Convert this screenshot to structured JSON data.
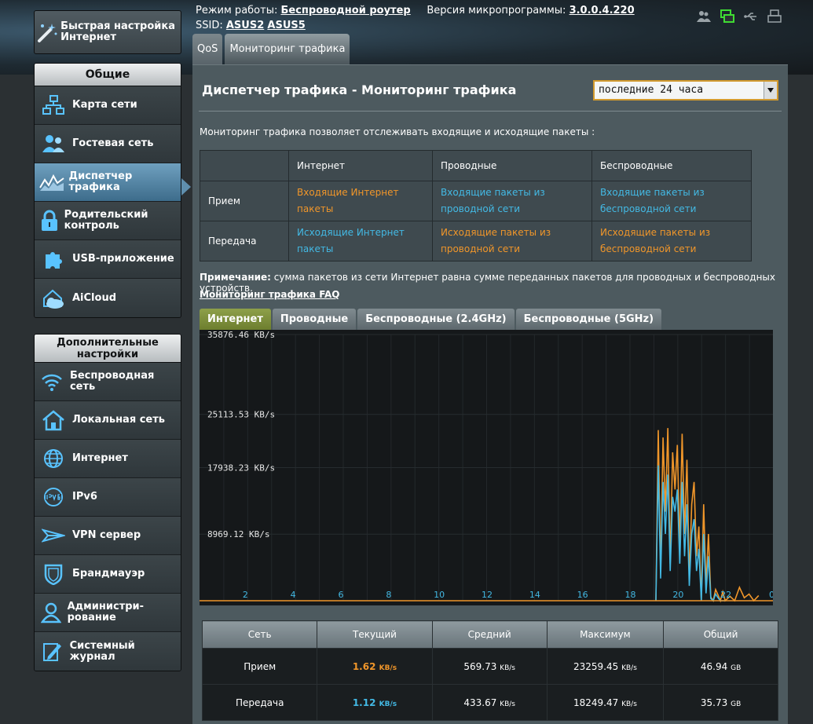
{
  "sidebar": {
    "qis_label": "Быстрая настройка Интернет",
    "general_header": "Общие",
    "general_items": [
      {
        "label": "Карта сети",
        "icon": "network-map-icon"
      },
      {
        "label": "Гостевая сеть",
        "icon": "guest-network-icon"
      },
      {
        "label": "Диспетчер трафика",
        "icon": "traffic-manager-icon",
        "active": true
      },
      {
        "label": "Родительский контроль",
        "icon": "parental-lock-icon"
      },
      {
        "label": "USB-приложение",
        "icon": "usb-puzzle-icon"
      },
      {
        "label": "AiCloud",
        "icon": "aicloud-icon"
      }
    ],
    "advanced_header": "Дополнительные настройки",
    "advanced_items": [
      {
        "label": "Беспроводная сеть",
        "icon": "wireless-icon"
      },
      {
        "label": "Локальная сеть",
        "icon": "home-lan-icon"
      },
      {
        "label": "Интернет",
        "icon": "globe-icon"
      },
      {
        "label": "IPv6",
        "icon": "ipv6-icon"
      },
      {
        "label": "VPN сервер",
        "icon": "vpn-icon"
      },
      {
        "label": "Брандмауэр",
        "icon": "firewall-shield-icon"
      },
      {
        "label": "Администри-рование",
        "icon": "admin-user-icon"
      },
      {
        "label": "Системный журнал",
        "icon": "system-log-icon"
      }
    ]
  },
  "topbar": {
    "mode_label": "Режим работы:",
    "mode_value": "Беспроводной роутер",
    "fw_label": "Версия микропрограммы:",
    "fw_value": "3.0.0.4.220",
    "ssid_label": "SSID:",
    "ssid1": "ASUS2",
    "ssid2": "ASUS5",
    "icons": [
      "clients-icon",
      "network-status-icon",
      "usb-status-icon",
      "printer-icon"
    ]
  },
  "tabs": [
    {
      "label": "QoS"
    },
    {
      "label": "Мониторинг трафика",
      "active": true
    }
  ],
  "main": {
    "title": "Диспетчер трафика - Мониторинг трафика",
    "period": "последние 24 часа",
    "description": "Мониторинг трафика позволяет отслеживать входящие и исходящие пакеты :",
    "legend": {
      "headers": [
        "",
        "Интернет",
        "Проводные",
        "Беспроводные"
      ],
      "rx_label": "Прием",
      "tx_label": "Передача",
      "rx": [
        "Входящие Интернет пакеты",
        "Входящие пакеты из проводной сети",
        "Входящие пакеты из беспроводной сети"
      ],
      "tx": [
        "Исходящие Интернет пакеты",
        "Исходящие пакеты из проводной сети",
        "Исходящие пакеты из беспроводной сети"
      ]
    },
    "note_label": "Примечание:",
    "note_text": "сумма пакетов из сети Интернет равна сумме переданных пакетов для проводных и беспроводных устройств.",
    "faq_link": "Мониторинг трафика FAQ",
    "chart_tabs": [
      {
        "label": "Интернет",
        "active": true
      },
      {
        "label": "Проводные"
      },
      {
        "label": "Беспроводные (2.4GHz)"
      },
      {
        "label": "Беспроводные (5GHz)"
      }
    ]
  },
  "chart_data": {
    "type": "line",
    "ylim": [
      0,
      35876.46
    ],
    "y_ticks": [
      "35876.46 KB/s",
      "25113.53 KB/s",
      "17938.23 KB/s",
      "8969.12 KB/s"
    ],
    "y_tick_values": [
      35876.46,
      25113.53,
      17938.23,
      8969.12
    ],
    "x_ticks": [
      "2",
      "4",
      "6",
      "8",
      "10",
      "12",
      "14",
      "16",
      "18",
      "20",
      "22",
      "0"
    ],
    "series": [
      {
        "color": "#f0962a",
        "x": [
          19.1,
          19.2,
          19.3,
          19.4,
          19.5,
          19.6,
          19.7,
          19.8,
          19.9,
          20.0,
          20.1,
          20.2,
          20.3,
          20.4,
          20.5,
          20.6,
          20.7,
          20.8,
          20.9,
          21.0,
          21.1,
          21.2,
          21.3,
          21.4,
          21.5,
          21.6,
          21.7,
          21.8,
          21.9,
          22.0,
          22.2,
          22.4,
          22.6,
          22.8,
          23.0,
          23.2,
          23.4
        ],
        "values": [
          0,
          23000,
          4000,
          22000,
          12000,
          23259,
          5000,
          20000,
          15000,
          21000,
          7000,
          22500,
          9000,
          19000,
          3000,
          13000,
          16000,
          6000,
          10000,
          0,
          13000,
          2000,
          9000,
          500,
          0,
          1500,
          800,
          0,
          1200,
          0,
          600,
          0,
          1800,
          400,
          900,
          0,
          700
        ]
      },
      {
        "color": "#43b9e4",
        "x": [
          19.1,
          19.2,
          19.3,
          19.4,
          19.5,
          19.6,
          19.7,
          19.8,
          19.9,
          20.0,
          20.1,
          20.2,
          20.3,
          20.4,
          20.5,
          20.6,
          20.7,
          20.8,
          20.9,
          21.0,
          21.1,
          21.2,
          21.3,
          21.4,
          21.5,
          21.6,
          21.7,
          21.8,
          22.0
        ],
        "values": [
          0,
          18249,
          3000,
          16000,
          9000,
          17000,
          4000,
          14000,
          12000,
          15000,
          5000,
          16000,
          6000,
          13000,
          2000,
          9000,
          11000,
          4000,
          7000,
          0,
          9000,
          1000,
          6000,
          300,
          0,
          900,
          400,
          0,
          0
        ]
      }
    ]
  },
  "stats": {
    "headers": [
      "Сеть",
      "Текущий",
      "Средний",
      "Максимум",
      "Общий"
    ],
    "rows": [
      {
        "label": "Прием",
        "current": "1.62",
        "current_unit": "KB/s",
        "avg": "569.73",
        "avg_unit": "KB/s",
        "max": "23259.45",
        "max_unit": "KB/s",
        "total": "46.94",
        "total_unit": "GB"
      },
      {
        "label": "Передача",
        "current": "1.12",
        "current_unit": "KB/s",
        "avg": "433.67",
        "avg_unit": "KB/s",
        "max": "18249.47",
        "max_unit": "KB/s",
        "total": "35.73",
        "total_unit": "GB"
      }
    ]
  },
  "colors": {
    "accent": "#d29a2e",
    "rx": "#f0962a",
    "tx": "#43b9e4",
    "active_tab": "#7a8c37"
  }
}
